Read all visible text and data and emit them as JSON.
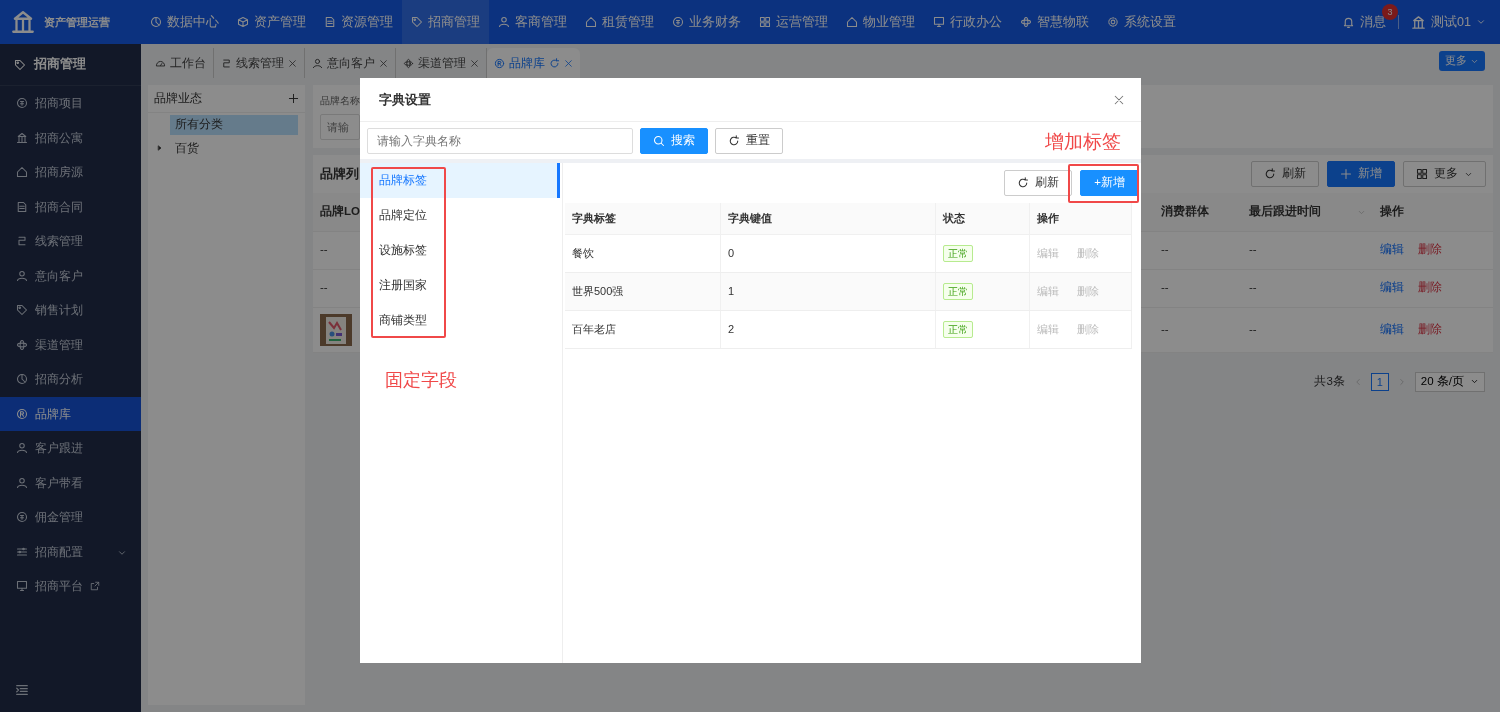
{
  "app": {
    "title": "资产管理运营"
  },
  "top_nav": [
    {
      "label": "数据中心",
      "selected": false
    },
    {
      "label": "资产管理",
      "selected": false
    },
    {
      "label": "资源管理",
      "selected": false
    },
    {
      "label": "招商管理",
      "selected": true
    },
    {
      "label": "客商管理",
      "selected": false
    },
    {
      "label": "租赁管理",
      "selected": false
    },
    {
      "label": "业务财务",
      "selected": false
    },
    {
      "label": "运营管理",
      "selected": false
    },
    {
      "label": "物业管理",
      "selected": false
    },
    {
      "label": "行政办公",
      "selected": false
    },
    {
      "label": "智慧物联",
      "selected": false
    },
    {
      "label": "系统设置",
      "selected": false
    }
  ],
  "notifications": {
    "label": "消息",
    "count": "3"
  },
  "user": {
    "name": "测试01"
  },
  "sidebar": {
    "title": "招商管理",
    "items": [
      {
        "label": "招商项目",
        "kind": "page",
        "selected": false
      },
      {
        "label": "招商公寓",
        "kind": "page",
        "selected": false
      },
      {
        "label": "招商房源",
        "kind": "page",
        "selected": false
      },
      {
        "label": "招商合同",
        "kind": "page",
        "selected": false
      },
      {
        "label": "线索管理",
        "kind": "page",
        "selected": false
      },
      {
        "label": "意向客户",
        "kind": "page",
        "selected": false
      },
      {
        "label": "销售计划",
        "kind": "page",
        "selected": false
      },
      {
        "label": "渠道管理",
        "kind": "page",
        "selected": false
      },
      {
        "label": "招商分析",
        "kind": "page",
        "selected": false
      },
      {
        "label": "品牌库",
        "kind": "page",
        "selected": true
      },
      {
        "label": "客户跟进",
        "kind": "page",
        "selected": false
      },
      {
        "label": "客户带看",
        "kind": "page",
        "selected": false
      },
      {
        "label": "佣金管理",
        "kind": "page",
        "selected": false
      },
      {
        "label": "招商配置",
        "kind": "group",
        "selected": false
      },
      {
        "label": "招商平台",
        "kind": "external",
        "selected": false
      }
    ]
  },
  "tabs": [
    {
      "label": "工作台",
      "selected": false,
      "closable": false
    },
    {
      "label": "线索管理",
      "selected": false,
      "closable": true
    },
    {
      "label": "意向客户",
      "selected": false,
      "closable": true
    },
    {
      "label": "渠道管理",
      "selected": false,
      "closable": true
    },
    {
      "label": "品牌库",
      "selected": true,
      "closable": true
    }
  ],
  "tabs_more": "更多",
  "category_tree": {
    "title": "品牌业态",
    "items": [
      {
        "label": "所有分类",
        "kind": "leaf",
        "selected": true
      },
      {
        "label": "百货",
        "kind": "branch",
        "selected": false,
        "expanded": false
      }
    ]
  },
  "filter": {
    "label": "品牌名称",
    "placeholder": "请输"
  },
  "brand_list": {
    "title": "品牌列",
    "buttons": [
      {
        "label": "刷新",
        "kind": "refresh"
      },
      {
        "label": "新增",
        "kind": "add"
      },
      {
        "label": "更多",
        "kind": "more"
      }
    ],
    "columns": [
      "品牌LO",
      "消费群体",
      "最后跟进时间",
      "操作"
    ],
    "rows": [
      {
        "logo": {
          "kind": "text",
          "text": "--"
        },
        "consumer_group": "--",
        "last_follow": "--",
        "actions": [
          "编辑",
          "删除"
        ]
      },
      {
        "logo": {
          "kind": "text",
          "text": "--"
        },
        "consumer_group": "--",
        "last_follow": "--",
        "actions": [
          "编辑",
          "删除"
        ]
      },
      {
        "logo": {
          "kind": "picture"
        },
        "consumer_group": "--",
        "last_follow": "--",
        "actions": [
          "编辑",
          "删除"
        ]
      }
    ],
    "pagination": {
      "total": "共3条",
      "pages": [
        {
          "label": "1",
          "selected": true
        }
      ],
      "page_size": "20 条/页"
    }
  },
  "dialog": {
    "title": "字典设置",
    "search_placeholder": "请输入字典名称",
    "search_button": "搜索",
    "reset_button": "重置",
    "dict_types": [
      {
        "label": "品牌标签",
        "selected": true
      },
      {
        "label": "品牌定位",
        "selected": false
      },
      {
        "label": "设施标签",
        "selected": false
      },
      {
        "label": "注册国家",
        "selected": false
      },
      {
        "label": "商铺类型",
        "selected": false
      }
    ],
    "toolbar": [
      {
        "label": "刷新",
        "kind": "refresh"
      },
      {
        "label": "+新增",
        "kind": "add"
      }
    ],
    "columns": [
      "字典标签",
      "字典键值",
      "状态",
      "操作"
    ],
    "rows": [
      {
        "label": "餐饮",
        "key": "0",
        "status": "正常",
        "actions": [
          {
            "label": "编辑",
            "disabled": true
          },
          {
            "label": "删除",
            "disabled": true
          }
        ]
      },
      {
        "label": "世界500强",
        "key": "1",
        "status": "正常",
        "actions": [
          {
            "label": "编辑",
            "disabled": true
          },
          {
            "label": "删除",
            "disabled": true
          }
        ]
      },
      {
        "label": "百年老店",
        "key": "2",
        "status": "正常",
        "actions": [
          {
            "label": "编辑",
            "disabled": true
          },
          {
            "label": "删除",
            "disabled": true
          }
        ]
      }
    ]
  },
  "annotations": [
    {
      "text": "增加标签"
    },
    {
      "text": "固定字段"
    }
  ]
}
